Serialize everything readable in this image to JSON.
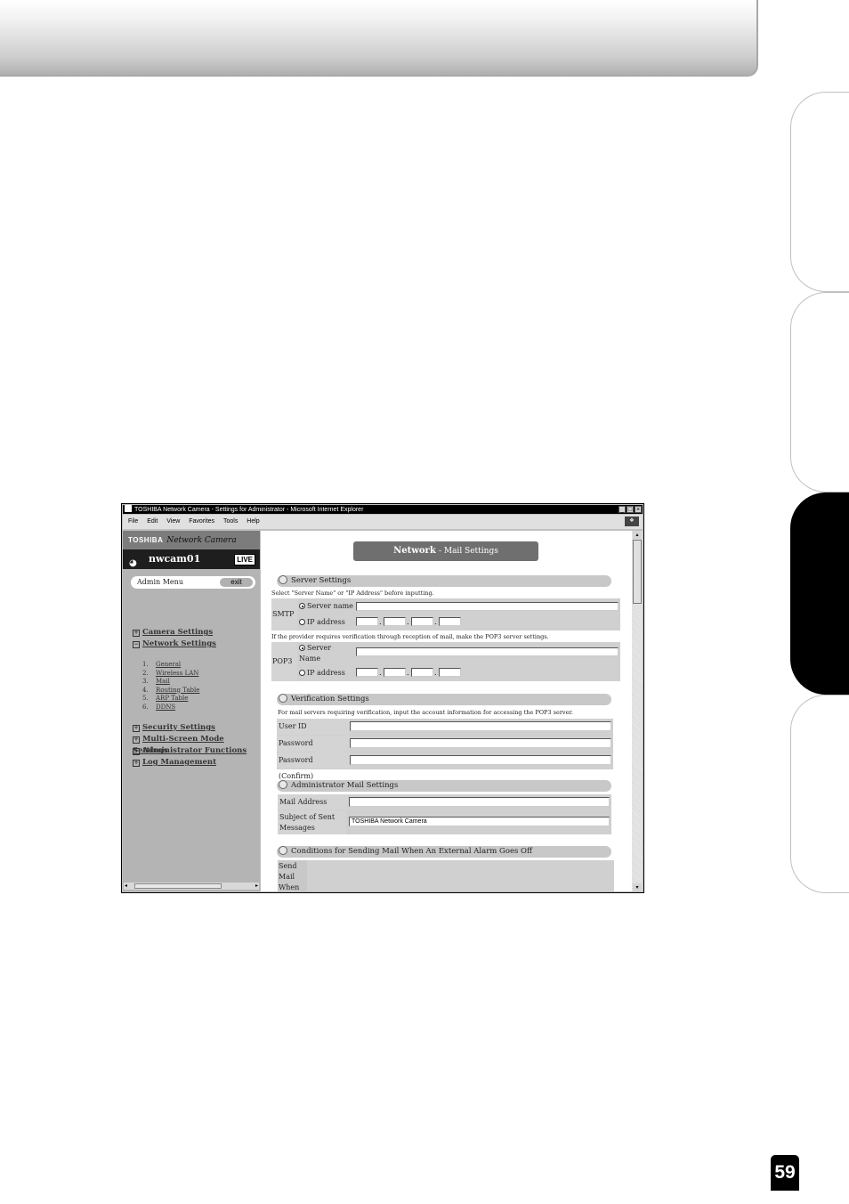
{
  "page_number": "59",
  "window": {
    "title": "TOSHIBA Network Camera - Settings for Administrator - Microsoft Internet Explorer",
    "buttons": [
      "_",
      "□",
      "×"
    ],
    "menu": [
      "File",
      "Edit",
      "View",
      "Favorites",
      "Tools",
      "Help"
    ]
  },
  "sidebar": {
    "brand": "TOSHIBA",
    "product": "Network Camera",
    "camera_name": "nwcam01",
    "live_label": "LIVE",
    "admin_menu": "Admin Menu",
    "exit_label": "exit",
    "groups_top": [
      {
        "label": "Camera Settings",
        "toggle": "+"
      },
      {
        "label": "Network Settings",
        "toggle": "−"
      }
    ],
    "subitems": [
      {
        "num": "1.",
        "label": "General"
      },
      {
        "num": "2.",
        "label": "Wireless LAN"
      },
      {
        "num": "3.",
        "label": "Mail"
      },
      {
        "num": "4.",
        "label": "Routing Table"
      },
      {
        "num": "5.",
        "label": "ARP Table"
      },
      {
        "num": "6.",
        "label": "DDNS"
      }
    ],
    "groups_bottom": [
      {
        "label": "Security Settings",
        "toggle": "+"
      },
      {
        "label": "Multi-Screen Mode Settings",
        "toggle": "+"
      },
      {
        "label": "Administrator Functions",
        "toggle": "+"
      },
      {
        "label": "Log Management",
        "toggle": "+"
      }
    ]
  },
  "content": {
    "title_strong": "Network",
    "title_light": "- Mail Settings",
    "server_settings": {
      "header": "Server Settings",
      "note": "Select \"Server Name\" or \"IP Address\" before inputting.",
      "smtp_label": "SMTP",
      "server_name_option": "Server name",
      "ip_address_option": "IP address",
      "pop3_note": "If the provider requires verification through reception of mail, make the POP3 server settings.",
      "pop3_label": "POP3",
      "pop3_server_option": "Server",
      "pop3_name_option": "Name",
      "pop3_ip_option": "IP address",
      "dot": "."
    },
    "verification": {
      "header": "Verification Settings",
      "note": "For mail servers requiring verification, input the account information for accessing the POP3 server.",
      "user_id": "User ID",
      "password": "Password",
      "password_confirm": "Password (Confirm)"
    },
    "admin_mail": {
      "header": "Administrator Mail Settings",
      "mail_address": "Mail Address",
      "subject_line1": "Subject of Sent",
      "subject_line2": "Messages",
      "subject_value": "TOSHIBA Network Camera"
    },
    "conditions": {
      "header": "Conditions for Sending Mail When An External Alarm Goes Off",
      "send_line1": "Send",
      "send_line2": "Mail",
      "send_line3": "When"
    }
  }
}
